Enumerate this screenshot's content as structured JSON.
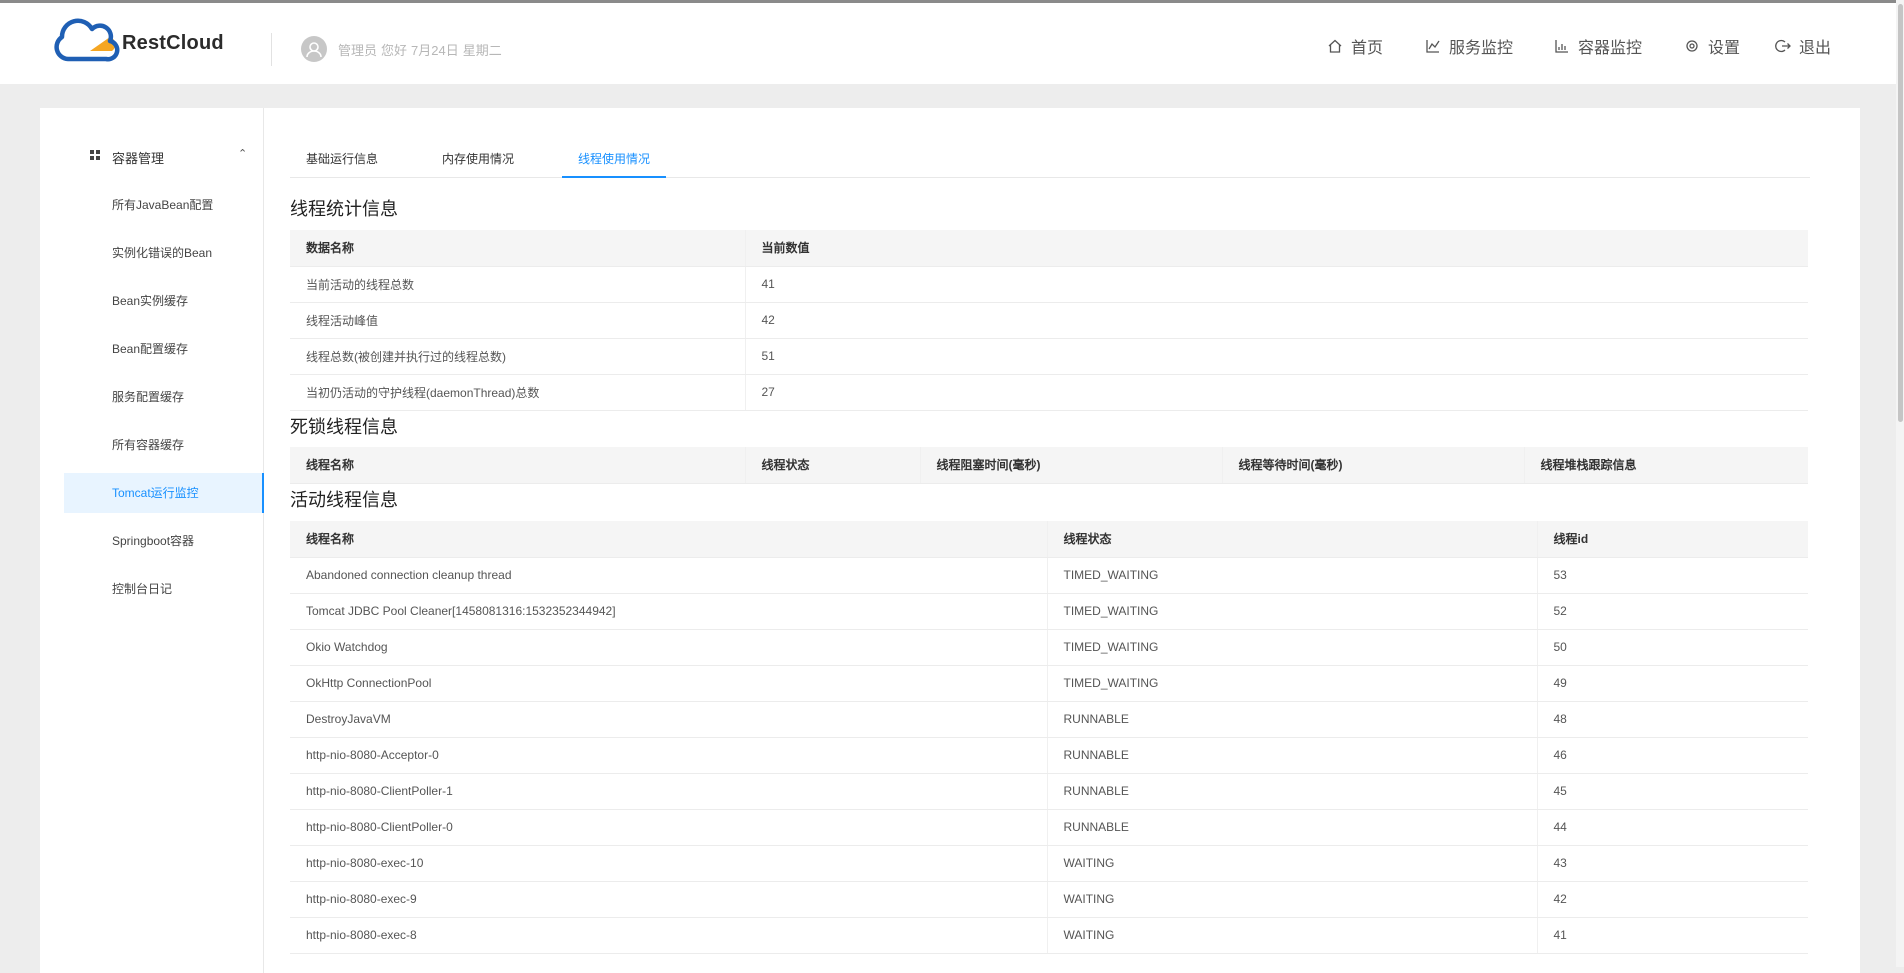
{
  "header": {
    "brand": "RestCloud",
    "greeting": {
      "role": "管理员",
      "hello": "您好",
      "date": "7月24日",
      "weekday": "星期二"
    },
    "nav": [
      {
        "label": "首页",
        "icon": "home-icon"
      },
      {
        "label": "服务监控",
        "icon": "line-chart-icon"
      },
      {
        "label": "容器监控",
        "icon": "bar-chart-icon"
      },
      {
        "label": "设置",
        "icon": "settings-icon"
      },
      {
        "label": "退出",
        "icon": "logout-icon"
      }
    ]
  },
  "sidebar": {
    "group": "容器管理",
    "items": [
      {
        "label": "所有JavaBean配置"
      },
      {
        "label": "实例化错误的Bean"
      },
      {
        "label": "Bean实例缓存"
      },
      {
        "label": "Bean配置缓存"
      },
      {
        "label": "服务配置缓存"
      },
      {
        "label": "所有容器缓存"
      },
      {
        "label": "Tomcat运行监控",
        "active": true
      },
      {
        "label": "Springboot容器"
      },
      {
        "label": "控制台日记"
      }
    ]
  },
  "tabs": [
    {
      "label": "基础运行信息"
    },
    {
      "label": "内存使用情况"
    },
    {
      "label": "线程使用情况",
      "active": true
    }
  ],
  "stats": {
    "title": "线程统计信息",
    "columns": [
      "数据名称",
      "当前数值"
    ],
    "rows": [
      [
        "当前活动的线程总数",
        "41"
      ],
      [
        "线程活动峰值",
        "42"
      ],
      [
        "线程总数(被创建并执行过的线程总数)",
        "51"
      ],
      [
        "当初仍活动的守护线程(daemonThread)总数",
        "27"
      ]
    ]
  },
  "deadlock": {
    "title": "死锁线程信息",
    "columns": [
      "线程名称",
      "线程状态",
      "线程阻塞时间(毫秒)",
      "线程等待时间(毫秒)",
      "线程堆栈跟踪信息"
    ]
  },
  "active": {
    "title": "活动线程信息",
    "columns": [
      "线程名称",
      "线程状态",
      "线程id"
    ],
    "rows": [
      [
        "Abandoned connection cleanup thread",
        "TIMED_WAITING",
        "53"
      ],
      [
        "Tomcat JDBC Pool Cleaner[1458081316:1532352344942]",
        "TIMED_WAITING",
        "52"
      ],
      [
        "Okio Watchdog",
        "TIMED_WAITING",
        "50"
      ],
      [
        "OkHttp ConnectionPool",
        "TIMED_WAITING",
        "49"
      ],
      [
        "DestroyJavaVM",
        "RUNNABLE",
        "48"
      ],
      [
        "http-nio-8080-Acceptor-0",
        "RUNNABLE",
        "46"
      ],
      [
        "http-nio-8080-ClientPoller-1",
        "RUNNABLE",
        "45"
      ],
      [
        "http-nio-8080-ClientPoller-0",
        "RUNNABLE",
        "44"
      ],
      [
        "http-nio-8080-exec-10",
        "WAITING",
        "43"
      ],
      [
        "http-nio-8080-exec-9",
        "WAITING",
        "42"
      ],
      [
        "http-nio-8080-exec-8",
        "WAITING",
        "41"
      ]
    ]
  },
  "colors": {
    "accent": "#1890ff",
    "logo_blue": "#1f5fb4",
    "logo_orange": "#f5a623"
  }
}
